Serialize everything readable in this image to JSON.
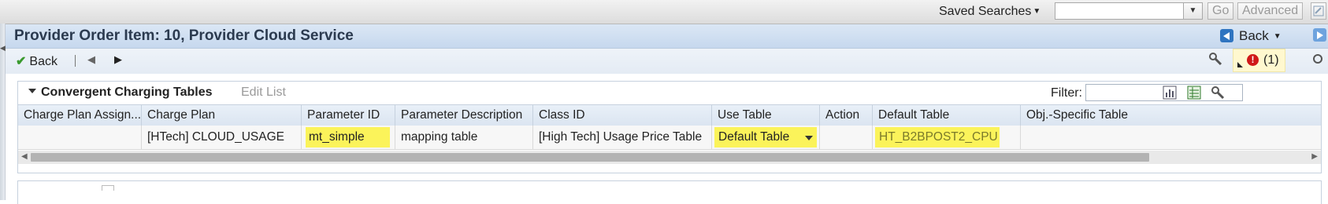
{
  "top": {
    "saved_searches_label": "Saved Searches",
    "go_label": "Go",
    "advanced_label": "Advanced"
  },
  "header": {
    "title": "Provider Order Item: 10, Provider Cloud Service",
    "back_label": "Back"
  },
  "toolbar": {
    "back_label": "Back",
    "messages_count": "(1)"
  },
  "block": {
    "title": "Convergent Charging Tables",
    "edit_list_label": "Edit List",
    "filter_label": "Filter:",
    "filter_value": "",
    "columns": [
      "Charge Plan Assign...",
      "Charge Plan",
      "Parameter ID",
      "Parameter Description",
      "Class ID",
      "Use Table",
      "Action",
      "Default Table",
      "Obj.-Specific Table"
    ],
    "rows": [
      {
        "charge_plan_assign": "",
        "charge_plan": "[HTech] CLOUD_USAGE",
        "parameter_id": "mt_simple",
        "parameter_description": "mapping table",
        "class_id": "[High Tech] Usage Price Table",
        "use_table": "Default Table",
        "action": "",
        "default_table": "HT_B2BPOST2_CPU",
        "obj_specific_table": ""
      }
    ]
  },
  "colors": {
    "header_bg": "#c6d8ee",
    "highlight": "#fbf35a",
    "error": "#d01818",
    "check": "#3a9a2e"
  }
}
